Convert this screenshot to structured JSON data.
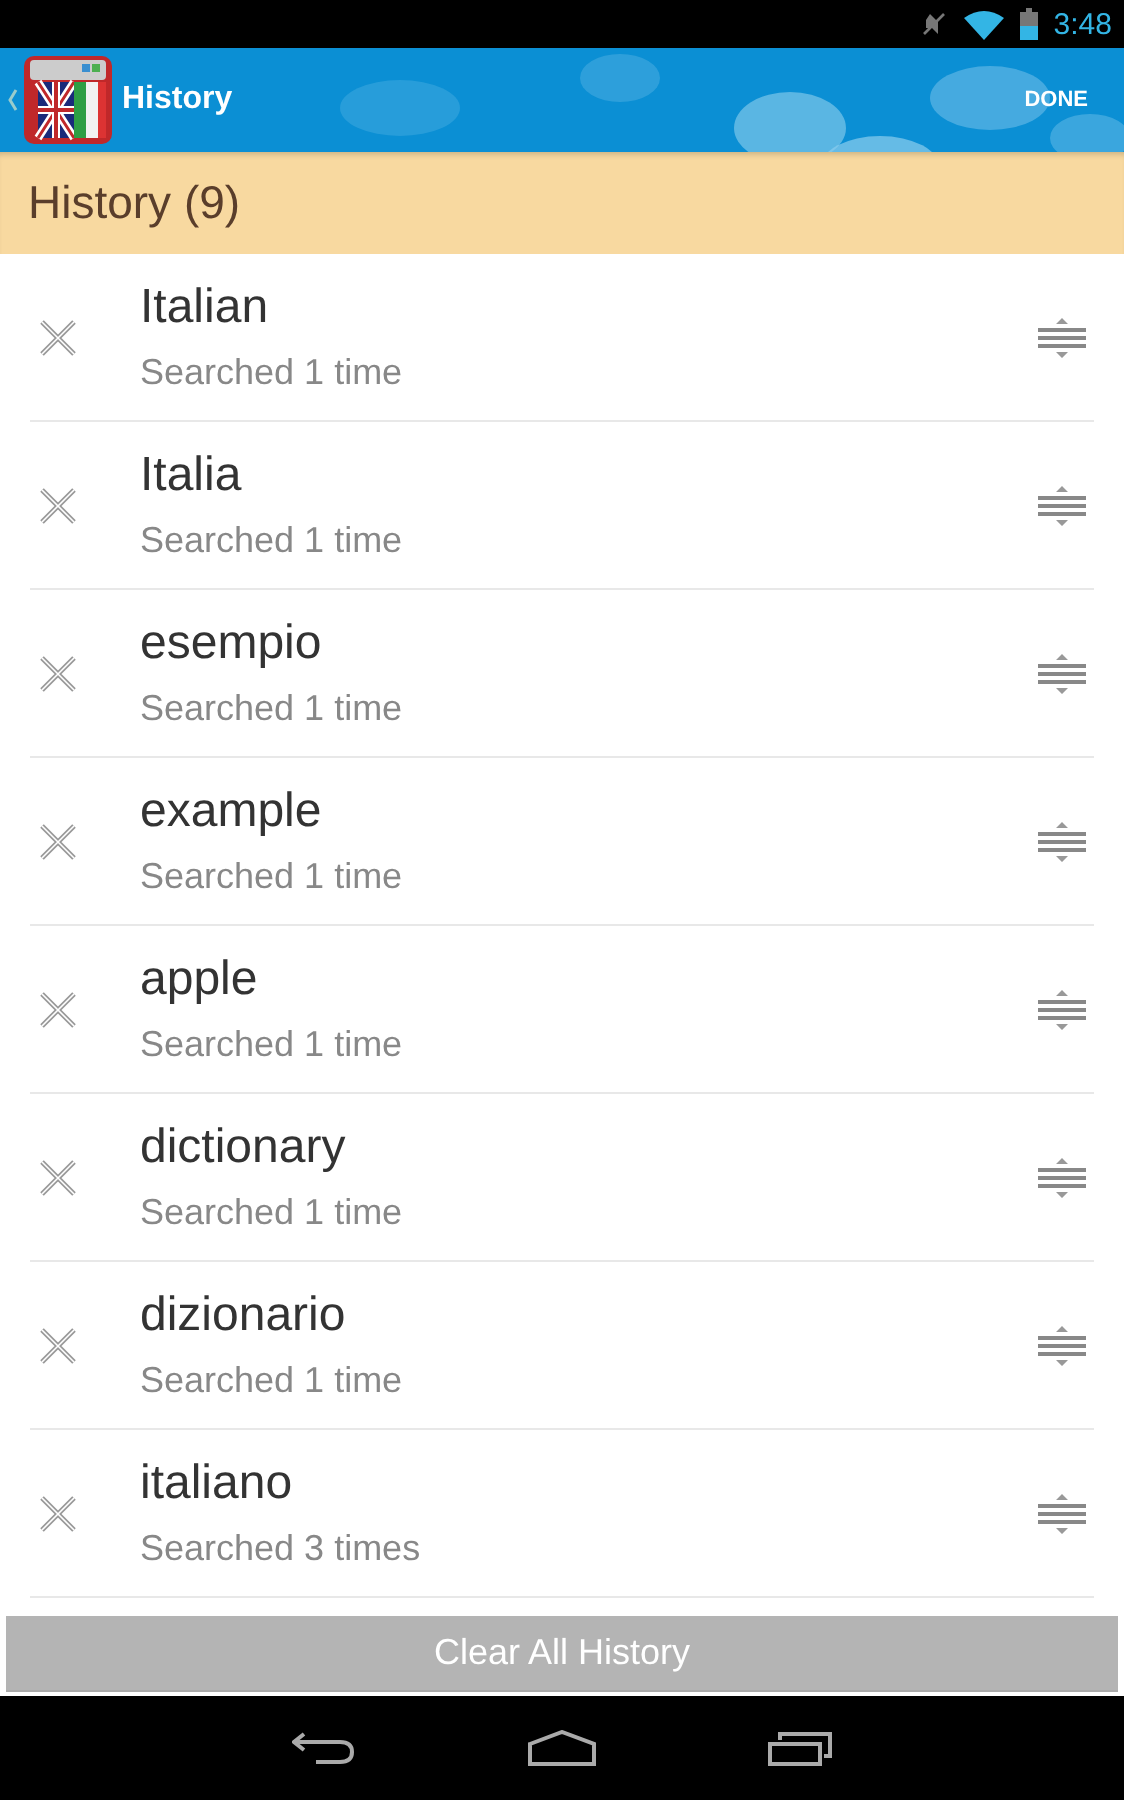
{
  "status_bar": {
    "time": "3:48"
  },
  "action_bar": {
    "title": "History",
    "done": "DONE"
  },
  "header": {
    "title": "History (9)"
  },
  "items": [
    {
      "word": "Italian",
      "count": "Searched 1 time"
    },
    {
      "word": "Italia",
      "count": "Searched 1 time"
    },
    {
      "word": "esempio",
      "count": "Searched 1 time"
    },
    {
      "word": "example",
      "count": "Searched 1 time"
    },
    {
      "word": "apple",
      "count": "Searched 1 time"
    },
    {
      "word": "dictionary",
      "count": "Searched 1 time"
    },
    {
      "word": "dizionario",
      "count": "Searched 1 time"
    },
    {
      "word": "italiano",
      "count": "Searched 3 times"
    }
  ],
  "clear_button": {
    "label": "Clear All History",
    "disabled": true
  }
}
